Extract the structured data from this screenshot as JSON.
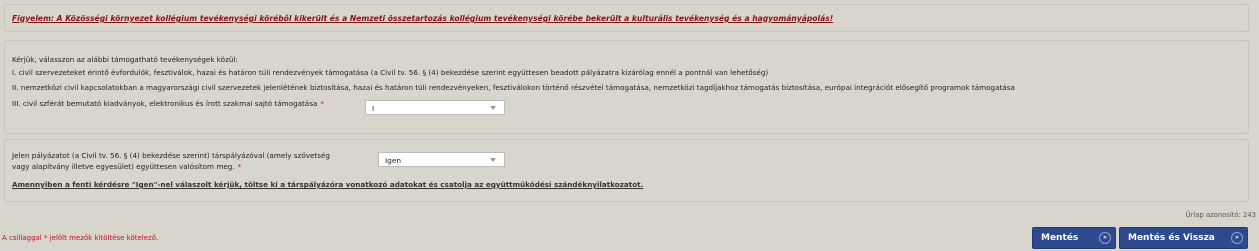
{
  "notice": "Figyelem: A Közösségi környezet kollégium tevékenységi köréből kikerült és a Nemzeti összetartozás kollégium tevékenységi körébe bekerült a kulturális tevékenység és a hagyományápolás!",
  "activity": {
    "intro": "Kérjük, válasszon az alábbi támogatható tevékenységek közül:",
    "items": [
      "I. civil szervezeteket érintő évfordulók, fesztiválok, hazai és határon túli rendezvények támogatása (a Civil tv. 56. § (4) bekezdése szerint együttesen beadott pályázatra kizárólag ennél a pontnál van lehetőség)",
      "II. nemzetközi civil kapcsolatokban a magyarországi civil szervezetek jelenlétének biztosítása, hazai és határon túli rendezvényeken, fesztiválokon történő részvétel támogatása, nemzetközi tagdíjakhoz támogatás biztosítása, európai integrációt elősegítő programok támogatása",
      "III. civil szférát bemutató kiadványok, elektronikus és írott szakmai sajtó támogatása"
    ],
    "required_mark": "*",
    "select_value": "I"
  },
  "partner": {
    "question_line1": "Jelen pályázatot (a Civil tv. 56. § (4) bekezdése szerint) társpályázóval (amely szövetség",
    "question_line2": "vagy alapítvány illetve egyesület) együttesen valósítom meg.",
    "required_mark": "*",
    "select_value": "Igen",
    "note": "Amennyiben a fenti kérdésre \"Igen\"-nel válaszolt kérjük, töltse ki a társpályázóra vonatkozó adatokat és csatolja az együttműködési szándéknyilatkozatot."
  },
  "footer": {
    "form_id": "Űrlap azonosító: 243",
    "required_note": "A csillaggal * jelölt mezők kitöltése kötelező.",
    "save_label": "Mentés",
    "save_back_label": "Mentés és Vissza"
  },
  "colors": {
    "background": "#d8d5cd",
    "notice": "#8a1111",
    "required": "#c0111b",
    "button": "#2d4a8f"
  }
}
